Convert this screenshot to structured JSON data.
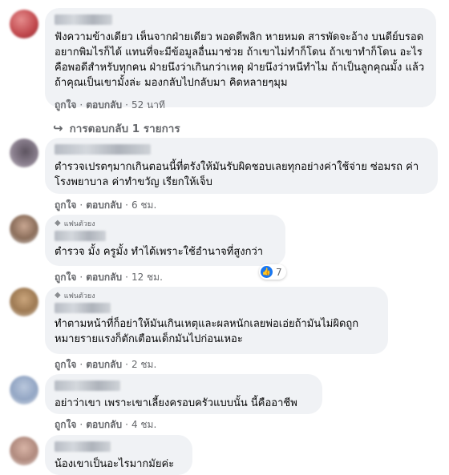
{
  "comments": [
    {
      "badge": "",
      "text": "ฟังความข้างเดียว เห็นจากฝ่ายเดียว พอดดีพลิก หายหมด สารพัดจะอ้าง บนดีย์บรอดอยากพิมไรก็ได้ แทนที่จะมีข้อมูลอื่นมาช่วย ถ้าเขาไม่ทำก็โดน ถ้าเขาทำก็โดน อะไรคือพอดีสำหรับทุกคน ฝ่ายนึงว่าเกินกว่าเหตุ ฝ่ายนึงว่าหนีทำไม ถ้าเป็นลูกคุณมั้ง แล้วถ้าคุณเป็นเขามั้งล่ะ มองกลับไปกลับมา คิดหลายๆมุม",
      "like": "ถูกใจ",
      "reply": "ตอบกลับ",
      "time": "52 นาที"
    },
    {
      "badge": "",
      "text": "ตำรวจเปรตๆมากเกินตอนนี้ที่ตรังให้มันรับผิดชอบเลยทุกอย่างค่าใช้จ่าย ซ่อมรถ ค่าโรงพยาบาล ค่าทำขวัญ เรียกให้เจ็บ",
      "like": "ถูกใจ",
      "reply": "ตอบกลับ",
      "time": "6 ชม."
    },
    {
      "badge": "แฟนตัวยง",
      "text": "ตำรวจ มั้ง ครูมั้ง ทำได้เพราะใช้อำนาจที่สูงกว่า",
      "like": "ถูกใจ",
      "reply": "ตอบกลับ",
      "time": "12 ชม.",
      "reaction_count": "7"
    },
    {
      "badge": "แฟนตัวยง",
      "text": "ทำตามหน้าที่ก็อย่าให้มันเกินเหตุและผลหนักเลยพ่อเอ่ยถ้ามันไม่ผิดถูกหมายรายแรงก็ตักเตือนเด็กมันไปก่อนเหอะ",
      "like": "ถูกใจ",
      "reply": "ตอบกลับ",
      "time": "2 ชม."
    },
    {
      "badge": "",
      "text": "อย่าว่าเขา เพราะเขาเลี้ยงครอบครัวแบบนั้น นี้คืออาชีพ",
      "like": "ถูกใจ",
      "reply": "ตอบกลับ",
      "time": "4 ชม."
    },
    {
      "badge": "",
      "text": "น้องเขาเป็นอะไรมากมัยค่ะ"
    }
  ],
  "replies_link": "การตอบกลับ 1 รายการ",
  "dot": "·",
  "icons": {
    "reply_arrow": "reply-arrow-icon",
    "badge": "diamond-icon",
    "reaction": "like-icon"
  },
  "colors": {
    "bubble": "#f0f2f5",
    "meta": "#65676b",
    "like": "#1877f2"
  }
}
